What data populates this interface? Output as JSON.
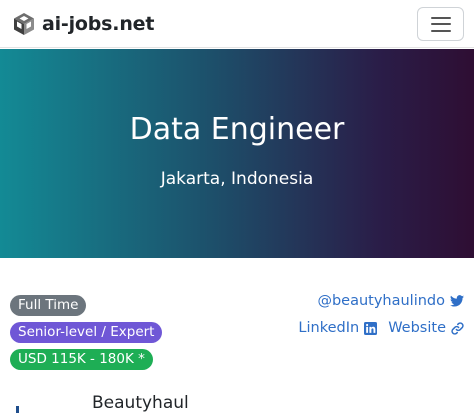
{
  "navbar": {
    "brand_icon": "cube-logo-icon",
    "brand_name": "ai-jobs.net",
    "menu_icon": "hamburger-menu-icon"
  },
  "hero": {
    "title": "Data Engineer",
    "location": "Jakarta, Indonesia"
  },
  "badges": {
    "employment_type": "Full Time",
    "level": "Senior-level / Expert",
    "salary": "USD 115K - 180K *"
  },
  "social": {
    "twitter_handle": "@beautyhaulindo",
    "twitter_icon": "twitter-icon",
    "linkedin_label": "LinkedIn",
    "linkedin_icon": "linkedin-icon",
    "website_label": "Website",
    "website_icon": "link-icon"
  },
  "company": {
    "name": "Beautyhaul"
  },
  "colors": {
    "hero_gradient_start": "#138a95",
    "hero_gradient_end": "#2e0e33",
    "badge_type": "#6c757d",
    "badge_level": "#6f57d6",
    "badge_salary": "#1eae55",
    "link": "#2f6fc7"
  }
}
